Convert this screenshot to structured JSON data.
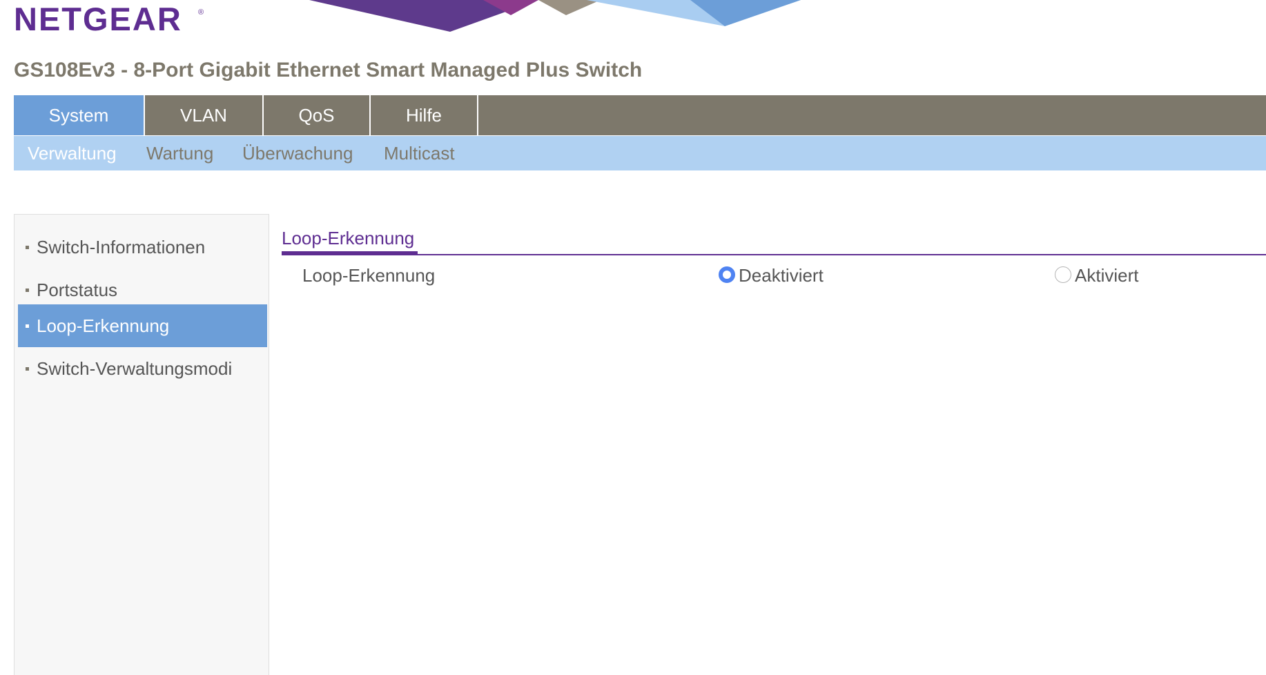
{
  "brand": {
    "logo_text": "NETGEAR",
    "logo_mark": "®",
    "colors": {
      "logo": "#5e2d91",
      "banner_purple": "#5e3a8c",
      "banner_magenta": "#8c3a8c",
      "banner_gray": "#9a9183",
      "banner_light_blue": "#a9cdf1",
      "banner_blue": "#6c9ed8"
    }
  },
  "header": {
    "product_title": "GS108Ev3 - 8-Port Gigabit Ethernet Smart Managed Plus Switch"
  },
  "main_nav": {
    "tabs": [
      {
        "label": "System",
        "active": true
      },
      {
        "label": "VLAN",
        "active": false
      },
      {
        "label": "QoS",
        "active": false
      },
      {
        "label": "Hilfe",
        "active": false
      }
    ]
  },
  "sub_nav": {
    "tabs": [
      {
        "label": "Verwaltung",
        "active": true
      },
      {
        "label": "Wartung",
        "active": false
      },
      {
        "label": "Überwachung",
        "active": false
      },
      {
        "label": "Multicast",
        "active": false
      }
    ]
  },
  "sidebar": {
    "items": [
      {
        "label": "Switch-Informationen",
        "active": false
      },
      {
        "label": "Portstatus",
        "active": false
      },
      {
        "label": "Loop-Erkennung",
        "active": true
      },
      {
        "label": "Switch-Verwaltungsmodi",
        "active": false
      }
    ]
  },
  "content": {
    "section_title": "Loop-Erkennung",
    "setting": {
      "label": "Loop-Erkennung",
      "options": [
        {
          "label": "Deaktiviert",
          "checked": true
        },
        {
          "label": "Aktiviert",
          "checked": false
        }
      ]
    }
  },
  "theme": {
    "nav_bg": "#7d786b",
    "active_blue": "#6c9ed8",
    "subnav_bg": "#b0d1f2",
    "accent_purple": "#5e2d91",
    "radio_checked": "#4f83f2"
  }
}
